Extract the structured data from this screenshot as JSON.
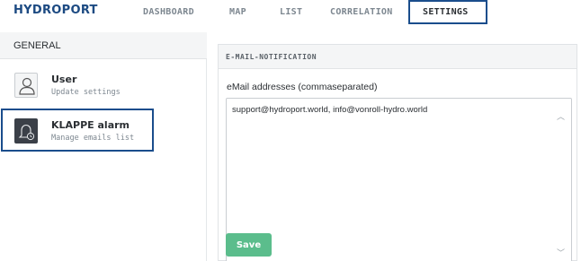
{
  "app": {
    "logo": "HYDROPORT"
  },
  "nav": {
    "tabs": [
      {
        "label": "DASHBOARD"
      },
      {
        "label": "MAP"
      },
      {
        "label": "LIST"
      },
      {
        "label": "CORRELATION"
      },
      {
        "label": "SETTINGS"
      }
    ],
    "active": "SETTINGS"
  },
  "sidebar": {
    "header": "GENERAL",
    "items": [
      {
        "title": "User",
        "subtitle": "Update settings",
        "icon": "user-icon"
      },
      {
        "title": "KLAPPE alarm",
        "subtitle": "Manage emails list",
        "icon": "bell-clock-icon"
      }
    ]
  },
  "panel": {
    "title": "E-MAIL-NOTIFICATION",
    "field_label": "eMail addresses (commaseparated)",
    "emails_value": "support@hydroport.world, info@vonroll-hydro.world",
    "save_label": "Save"
  },
  "colors": {
    "brand": "#1c4a82",
    "highlight": "#1a4d8c",
    "save": "#5bbd8c"
  }
}
